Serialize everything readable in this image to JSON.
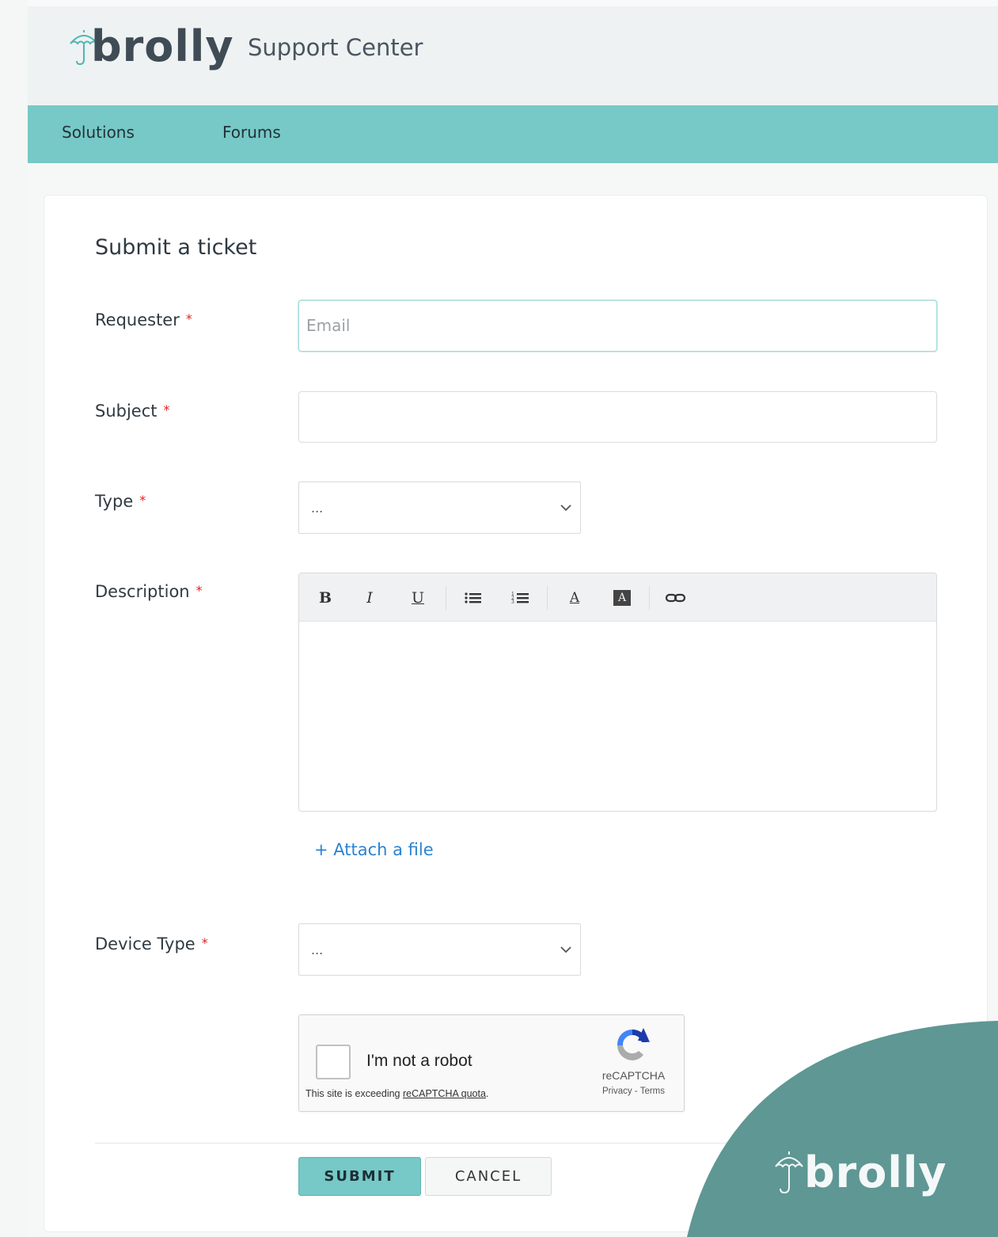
{
  "header": {
    "brand": "brolly",
    "title": "Support Center",
    "umbrella_icon": "umbrella-icon",
    "colors": {
      "header_bg": "#eef2f2",
      "brand_text": "#3f4b55",
      "umbrella_stroke": "#4fb6b3"
    }
  },
  "nav": {
    "items": [
      {
        "label": "Solutions"
      },
      {
        "label": "Forums"
      }
    ],
    "color": "#76c9c6"
  },
  "form": {
    "title": "Submit a ticket",
    "required_marker": "*",
    "requester": {
      "label": "Requester",
      "placeholder": "Email",
      "value": ""
    },
    "subject": {
      "label": "Subject",
      "value": ""
    },
    "type": {
      "label": "Type",
      "selected": "..."
    },
    "description": {
      "label": "Description",
      "toolbar": {
        "bold": "B",
        "italic": "I",
        "underline": "U",
        "font_color": "A",
        "bg_color": "A",
        "icons": [
          "bold-icon",
          "italic-icon",
          "underline-icon",
          "bulleted-list-icon",
          "numbered-list-icon",
          "font-color-icon",
          "background-color-icon",
          "link-icon"
        ]
      },
      "value": ""
    },
    "attach_label": "+ Attach a file",
    "device_type": {
      "label": "Device Type",
      "selected": "..."
    },
    "captcha": {
      "checkbox_label": "I'm not a robot",
      "quota_text": "This site is exceeding ",
      "quota_link": "reCAPTCHA quota",
      "quota_end": ".",
      "brand": "reCAPTCHA",
      "privacy_terms": "Privacy - Terms"
    },
    "buttons": {
      "submit": "SUBMIT",
      "cancel": "CANCEL"
    },
    "colors": {
      "required": "#e02020",
      "link": "#2b83d1",
      "submit_bg": "#76c9c6"
    }
  },
  "corner_badge": {
    "brand": "brolly",
    "color": "#5e9794"
  }
}
